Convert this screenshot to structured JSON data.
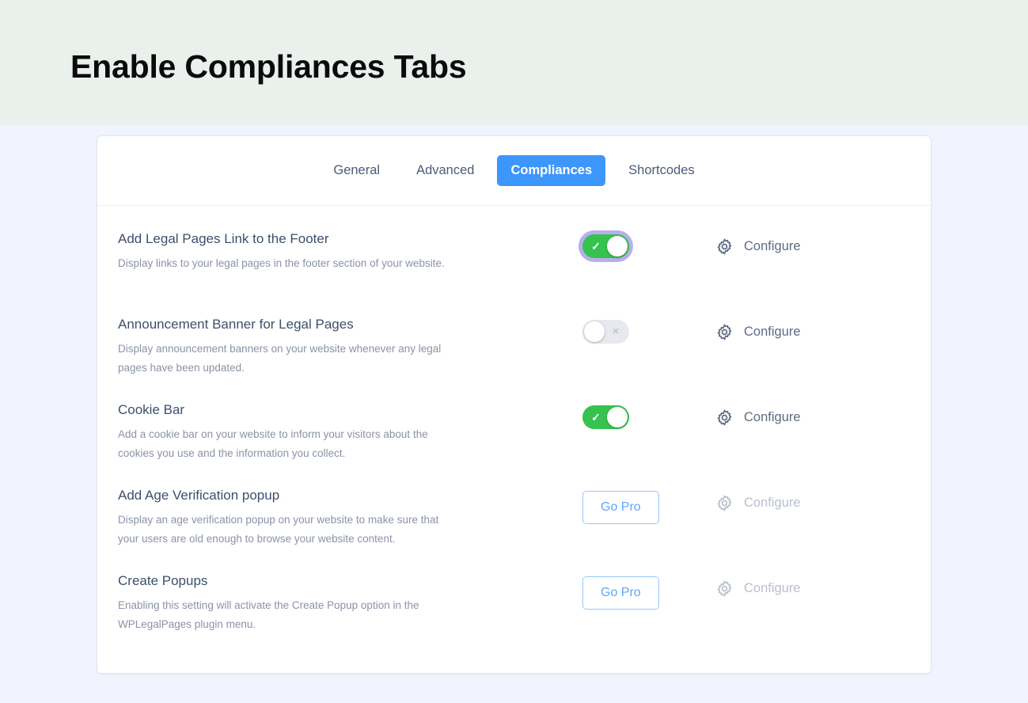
{
  "hero": {
    "title": "Enable Compliances Tabs",
    "background_color": "#eaf0ec"
  },
  "page": {
    "background_color": "#f1f4fe"
  },
  "tabs": {
    "active_color": "#3d96fb",
    "items": [
      {
        "label": "General",
        "active": false
      },
      {
        "label": "Advanced",
        "active": false
      },
      {
        "label": "Compliances",
        "active": true
      },
      {
        "label": "Shortcodes",
        "active": false
      }
    ]
  },
  "settings": {
    "configure_label": "Configure",
    "gopro_label": "Go Pro",
    "toggle_on_color": "#36c24f",
    "toggle_off_color": "#e7e9ef",
    "focus_ring_color": "#b9aeec",
    "rows": [
      {
        "title": "Add Legal Pages Link to the Footer",
        "description": "Display links to your legal pages in the footer section of your website.",
        "control": "toggle",
        "toggle_state": "on",
        "toggle_mark": "✓",
        "focused": true,
        "configure_enabled": true
      },
      {
        "title": "Announcement Banner for Legal Pages",
        "description": "Display announcement banners on your website whenever any legal pages have been updated.",
        "control": "toggle",
        "toggle_state": "off",
        "toggle_mark": "×",
        "focused": false,
        "configure_enabled": true
      },
      {
        "title": "Cookie Bar",
        "description": "Add a cookie bar on your website to inform your visitors about the cookies you use and the information you collect.",
        "control": "toggle",
        "toggle_state": "on",
        "toggle_mark": "✓",
        "focused": false,
        "configure_enabled": true
      },
      {
        "title": "Add Age Verification popup",
        "description": "Display an age verification popup on your website to make sure that your users are old enough to browse your website content.",
        "control": "gopro",
        "configure_enabled": false
      },
      {
        "title": "Create Popups",
        "description": "Enabling this setting will activate the Create Popup option in the WPLegalPages plugin menu.",
        "control": "gopro",
        "configure_enabled": false
      }
    ]
  }
}
